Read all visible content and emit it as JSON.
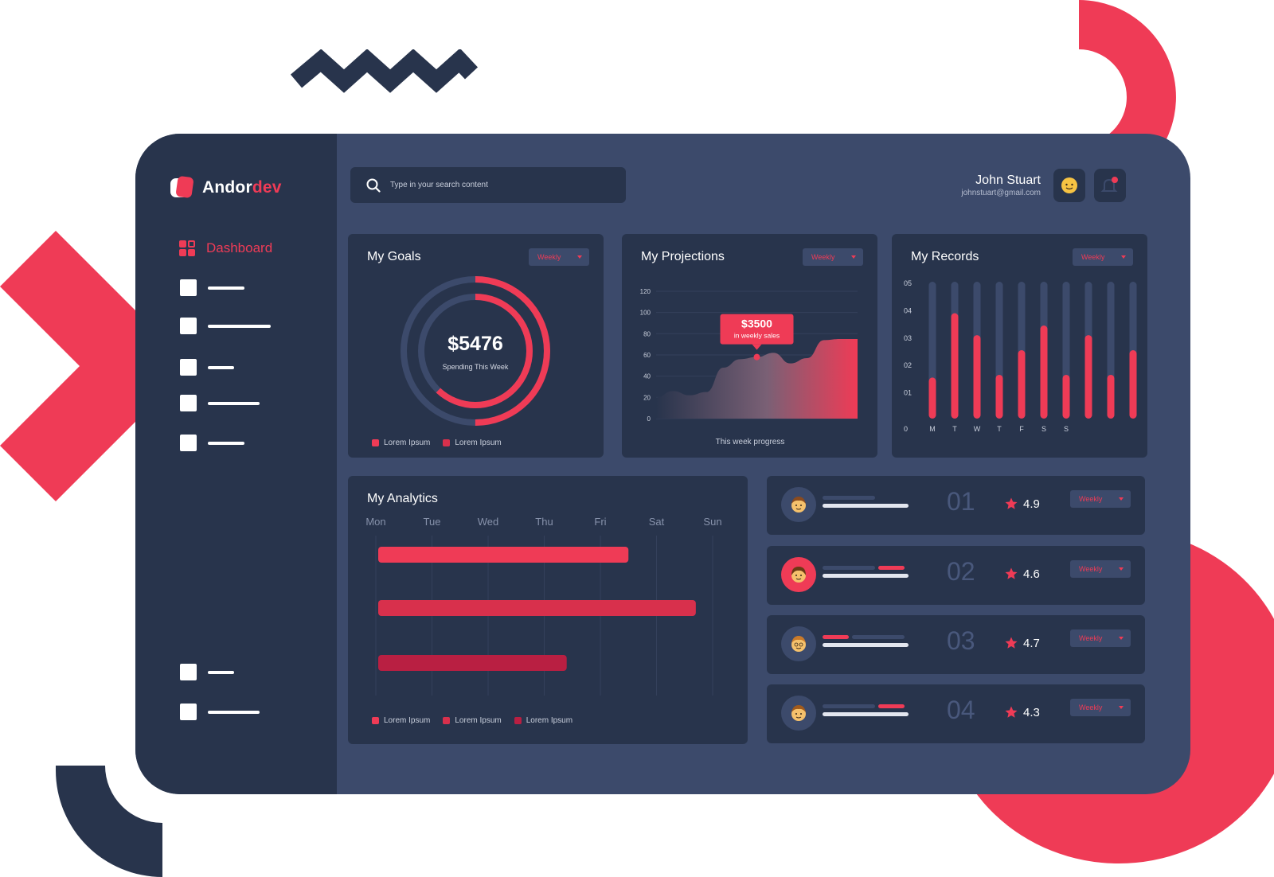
{
  "brand": {
    "name_part1": "Andor",
    "name_part2": "dev"
  },
  "sidebar": {
    "active_label": "Dashboard"
  },
  "search": {
    "placeholder": "Type in your search content"
  },
  "user": {
    "name": "John Stuart",
    "email": "johnstuart@gmail.com"
  },
  "colors": {
    "accent": "#ef3b56",
    "panel": "#28344c",
    "surface": "#3c4a6b",
    "muted": "#49587c"
  },
  "goals": {
    "title": "My Goals",
    "filter": "Weekly",
    "amount": "$5476",
    "caption": "Spending This Week",
    "outer_progress": 0.5,
    "inner_progress": 0.62,
    "legend": [
      "Lorem Ipsum",
      "Lorem Ipsum"
    ]
  },
  "projections": {
    "title": "My Projections",
    "filter": "Weekly",
    "tooltip_value": "$3500",
    "tooltip_label": "in weekly sales",
    "caption": "This week progress"
  },
  "records": {
    "title": "My Records",
    "filter": "Weekly"
  },
  "analytics": {
    "title": "My Analytics",
    "days": [
      "Mon",
      "Tue",
      "Wed",
      "Thu",
      "Fri",
      "Sat",
      "Sun"
    ],
    "legend": [
      "Lorem Ipsum",
      "Lorem Ipsum",
      "Lorem Ipsum"
    ]
  },
  "rankings": [
    {
      "rank": "01",
      "rating": "4.9",
      "filter": "Weekly"
    },
    {
      "rank": "02",
      "rating": "4.6",
      "filter": "Weekly"
    },
    {
      "rank": "03",
      "rating": "4.7",
      "filter": "Weekly"
    },
    {
      "rank": "04",
      "rating": "4.3",
      "filter": "Weekly"
    }
  ],
  "chart_data": [
    {
      "type": "area",
      "y_ticks": [
        "120",
        "100",
        "80",
        "60",
        "40",
        "20",
        "0"
      ],
      "ylim": [
        0,
        120
      ],
      "x": [
        0,
        1,
        2,
        3,
        4,
        5,
        6,
        7,
        8,
        9,
        10,
        11,
        12
      ],
      "values": [
        20,
        26,
        22,
        25,
        48,
        56,
        58,
        62,
        52,
        57,
        74,
        75,
        75
      ],
      "highlight_index": 6,
      "grid": true
    },
    {
      "type": "bar",
      "y_ticks": [
        "05",
        "04",
        "03",
        "02",
        "01",
        "0"
      ],
      "x_labels": [
        "M",
        "T",
        "W",
        "T",
        "F",
        "S",
        "S"
      ],
      "ylim": [
        0,
        5
      ],
      "max_values": [
        5,
        5,
        5,
        5,
        5,
        5,
        5,
        5,
        5,
        5
      ],
      "values": [
        1.5,
        3.85,
        3.05,
        1.6,
        2.5,
        3.4,
        1.6,
        3.05,
        1.6,
        2.5
      ]
    },
    {
      "type": "bar",
      "orientation": "horizontal",
      "categories": [
        "Mon",
        "Tue",
        "Wed",
        "Thu",
        "Fri",
        "Sat",
        "Sun"
      ],
      "series": [
        {
          "start": 0,
          "end": 4.5,
          "color": "#ef3b56"
        },
        {
          "start": 0,
          "end": 5.7,
          "color": "#d8304c"
        },
        {
          "start": 0,
          "end": 3.4,
          "color": "#b91f42"
        }
      ]
    }
  ]
}
